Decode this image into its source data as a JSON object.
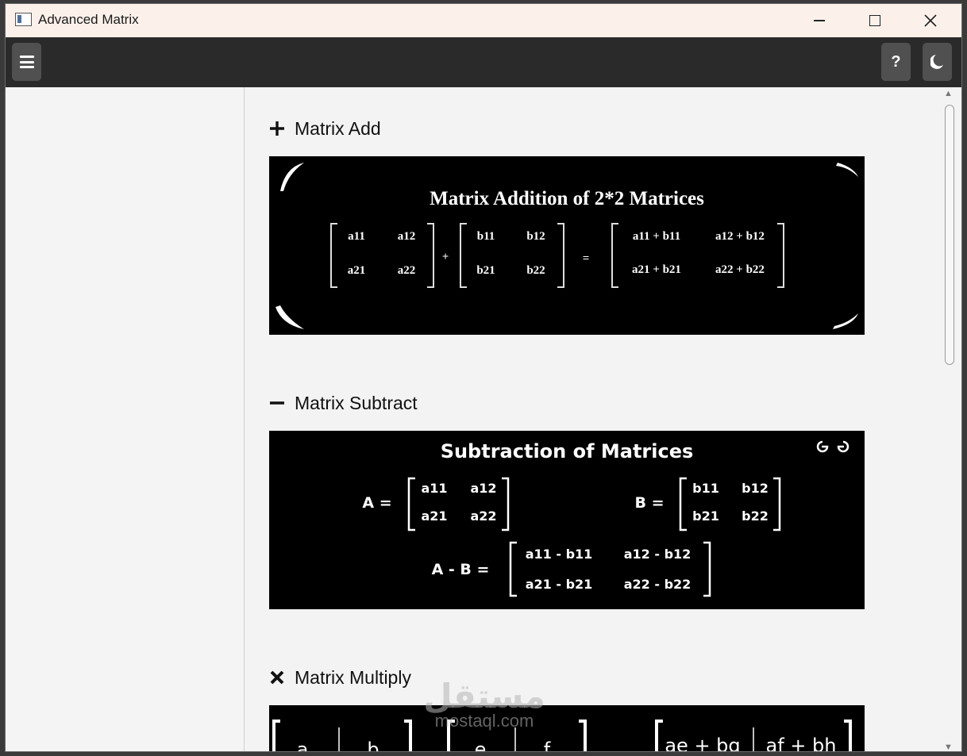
{
  "window": {
    "title": "Advanced Matrix"
  },
  "toolbar": {
    "help_label": "?"
  },
  "sections": [
    {
      "title": "Matrix Add",
      "icon": "plus-icon",
      "image": {
        "heading": "Matrix Addition of 2*2 Matrices",
        "matrix_a": [
          [
            "a11",
            "a12"
          ],
          [
            "a21",
            "a22"
          ]
        ],
        "matrix_b": [
          [
            "b11",
            "b12"
          ],
          [
            "b21",
            "b22"
          ]
        ],
        "result": [
          [
            "a11 + b11",
            "a12 + b12"
          ],
          [
            "a21 + b21",
            "a22 + b22"
          ]
        ],
        "plus": "+",
        "equals": "="
      }
    },
    {
      "title": "Matrix Subtract",
      "icon": "minus-icon",
      "image": {
        "heading": "Subtraction of Matrices",
        "logo": "GfG",
        "label_a": "A =",
        "label_b": "B =",
        "label_ab": "A - B =",
        "matrix_a": [
          [
            "a11",
            "a12"
          ],
          [
            "a21",
            "a22"
          ]
        ],
        "matrix_b": [
          [
            "b11",
            "b12"
          ],
          [
            "b21",
            "b22"
          ]
        ],
        "result": [
          [
            "a11 - b11",
            "a12 - b12"
          ],
          [
            "a21 - b21",
            "a22 - b22"
          ]
        ]
      }
    },
    {
      "title": "Matrix Multiply",
      "icon": "times-icon",
      "image": {
        "matrix_a_row": [
          "a",
          "b"
        ],
        "matrix_b_row": [
          "e",
          "f"
        ],
        "result_row": [
          "ae + bg",
          "af + bh"
        ]
      }
    }
  ],
  "watermark": {
    "arabic": "مستقل",
    "latin": "mostaql.com"
  }
}
